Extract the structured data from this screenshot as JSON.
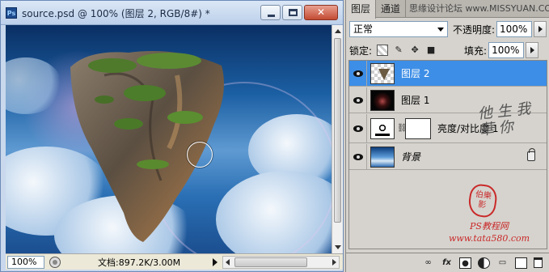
{
  "document": {
    "title": "source.psd @ 100% (图层 2, RGB/8#) *",
    "app_icon": "Ps",
    "window_buttons": {
      "minimize": "minimize-icon",
      "maximize": "maximize-icon",
      "close": "✕"
    },
    "zoom": "100%",
    "doc_info": "文档:897.2K/3.00M"
  },
  "panel": {
    "tabs": [
      "图层",
      "通道"
    ],
    "tab_watermark": "思缘设计论坛 www.MISSYUAN.COM",
    "blend_mode": "正常",
    "opacity_label": "不透明度:",
    "opacity_value": "100%",
    "lock_label": "锁定:",
    "fill_label": "填充:",
    "fill_value": "100%",
    "layers": [
      {
        "name": "图层 2",
        "selected": true,
        "thumb": "rock"
      },
      {
        "name": "图层 1",
        "selected": false,
        "thumb": "dark"
      },
      {
        "name": "亮度/对比度 1",
        "selected": false,
        "thumb": "adjustment"
      },
      {
        "name": "背景",
        "selected": false,
        "thumb": "background",
        "locked": true
      }
    ],
    "footer_icons": [
      "link-icon",
      "fx-icon",
      "mask-icon",
      "adjustment-icon",
      "folder-icon",
      "new-layer-icon",
      "trash-icon"
    ]
  },
  "watermarks": {
    "calligraphy": "他 生 我 華 你",
    "seal": "伯樂 影",
    "site_line1": "PS教程网",
    "site_line2": "www.tata580.com"
  }
}
